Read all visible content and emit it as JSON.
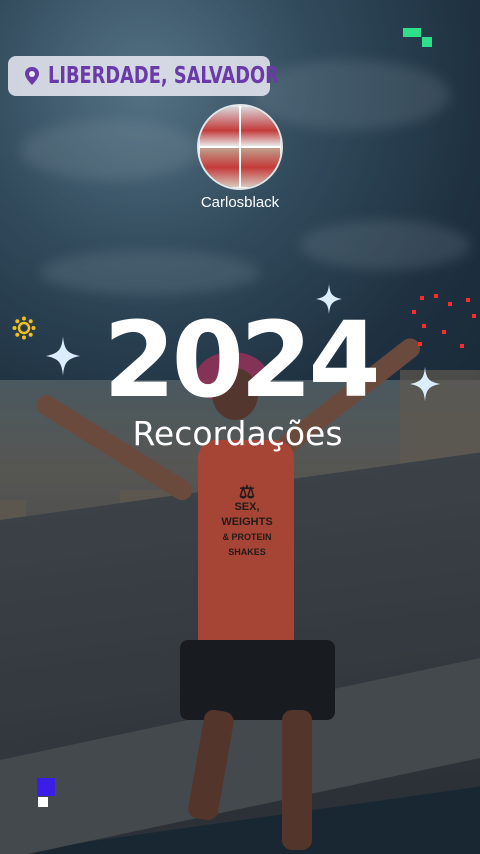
{
  "location": {
    "text": "LIBERDADE, SALVADOR",
    "icon": "map-pin-icon",
    "color": "#6a3aa8"
  },
  "profile": {
    "username": "Carlosblack"
  },
  "headline": {
    "year": "2024",
    "subtitle": "Recordações"
  },
  "shirt_print": {
    "line1": "SEX, WEIGHTS",
    "line2": "& PROTEIN SHAKES"
  },
  "colors": {
    "sparkle": "#dbeeff",
    "firework": "#ff2a2a",
    "sun": "#f2c21a",
    "green_deco": "#2fe08a",
    "blue_deco": "#3a1ee8"
  }
}
